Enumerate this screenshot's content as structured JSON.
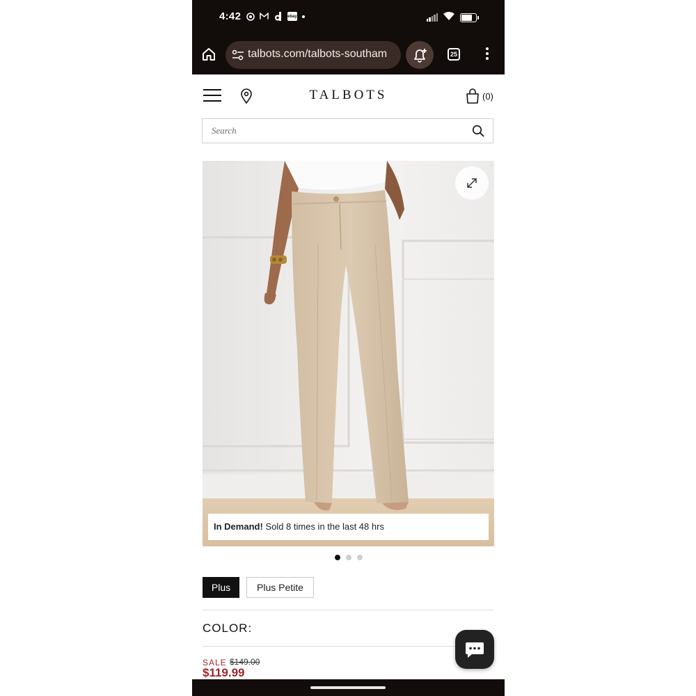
{
  "status_bar": {
    "time": "4:42",
    "icons": [
      "chrome-icon",
      "gmail-icon",
      "app-d-icon",
      "ebay-icon",
      "notification-dot",
      "signal-icon",
      "wifi-icon",
      "battery-icon"
    ],
    "ebay_label": "ebay"
  },
  "browser": {
    "url": "talbots.com/talbots-southam",
    "tab_count": "25"
  },
  "site": {
    "logo": "TALBOTS",
    "bag_count": "(0)",
    "search_placeholder": "Search"
  },
  "product": {
    "image_description": "model wearing beige linen pants",
    "badge_bold": "In Demand!",
    "badge_text": " Sold 8 times in the last 48 hrs",
    "carousel": {
      "count": 3,
      "active_index": 0
    },
    "size_options": [
      {
        "label": "Plus",
        "selected": true
      },
      {
        "label": "Plus Petite",
        "selected": false
      }
    ],
    "color_label": "COLOR:",
    "sale_label": "SALE",
    "original_price": "$149.00",
    "sale_price": "$119.99"
  },
  "colors": {
    "chrome_bg": "#120c0a",
    "sale_red": "#a0262c",
    "selected_size": "#111111"
  }
}
